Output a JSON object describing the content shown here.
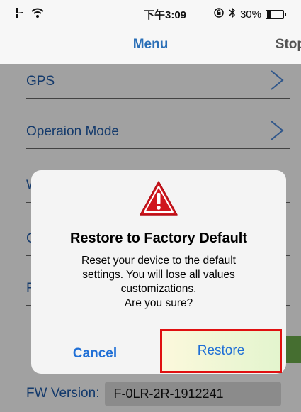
{
  "status_bar": {
    "time": "下午3:09",
    "battery": "30%",
    "battery_level": 0.3,
    "icons": [
      "airplane-icon",
      "wifi-icon",
      "rotation-lock-icon",
      "bluetooth-icon",
      "battery-icon"
    ]
  },
  "nav": {
    "title": "Menu",
    "right_action": "Stop"
  },
  "menu": {
    "items": [
      {
        "label": "GPS"
      },
      {
        "label": "Operaion Mode"
      },
      {
        "label": "W"
      },
      {
        "label": "C"
      },
      {
        "label": "F"
      }
    ]
  },
  "footer": {
    "fw_label": "FW Version:",
    "fw_value": "F-0LR-2R-1912241"
  },
  "alert": {
    "icon": "warning-triangle-icon",
    "title": "Restore to Factory Default",
    "message_lines": [
      "Reset your device to the default",
      "settings. You will lose all values",
      "customizations.",
      "Are you sure?"
    ],
    "cancel_label": "Cancel",
    "restore_label": "Restore"
  },
  "colors": {
    "accent_blue": "#1f6fd6",
    "label_blue": "#1f5aa6",
    "warning_red": "#d0161e",
    "highlight_red": "#e01010"
  }
}
